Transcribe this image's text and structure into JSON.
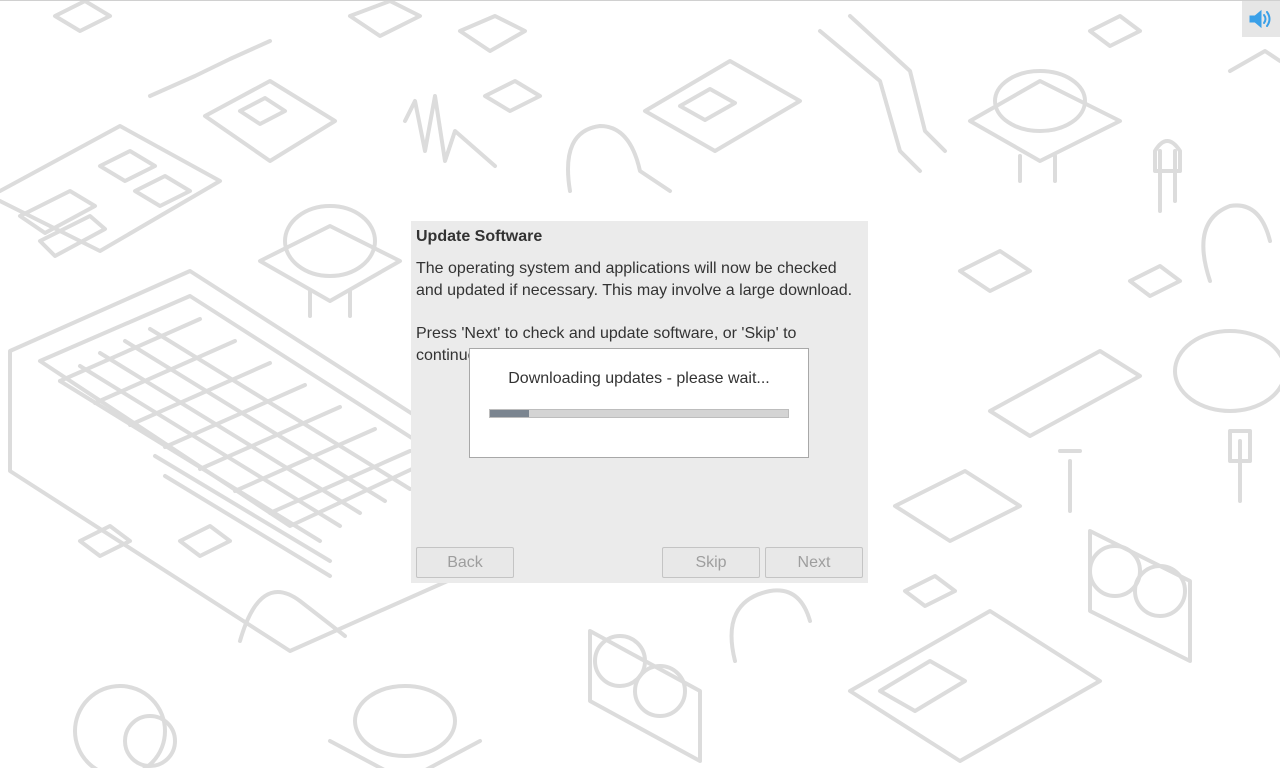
{
  "wizard": {
    "title": "Update Software",
    "description": "The operating system and applications will now be checked and updated if necessary. This may involve a large download.",
    "instruction": "Press 'Next' to check and update software, or 'Skip' to continue without",
    "buttons": {
      "back": "Back",
      "skip": "Skip",
      "next": "Next"
    }
  },
  "progress_dialog": {
    "message": "Downloading updates - please wait...",
    "progress_fraction": 0.13
  },
  "system_tray": {
    "volume_icon": "speaker-volume-icon"
  },
  "colors": {
    "wallpaper_line": "#dcdcdc",
    "dialog_bg": "#ebebeb",
    "progress_fill": "#7b8590",
    "volume_icon": "#3aa0e8"
  }
}
